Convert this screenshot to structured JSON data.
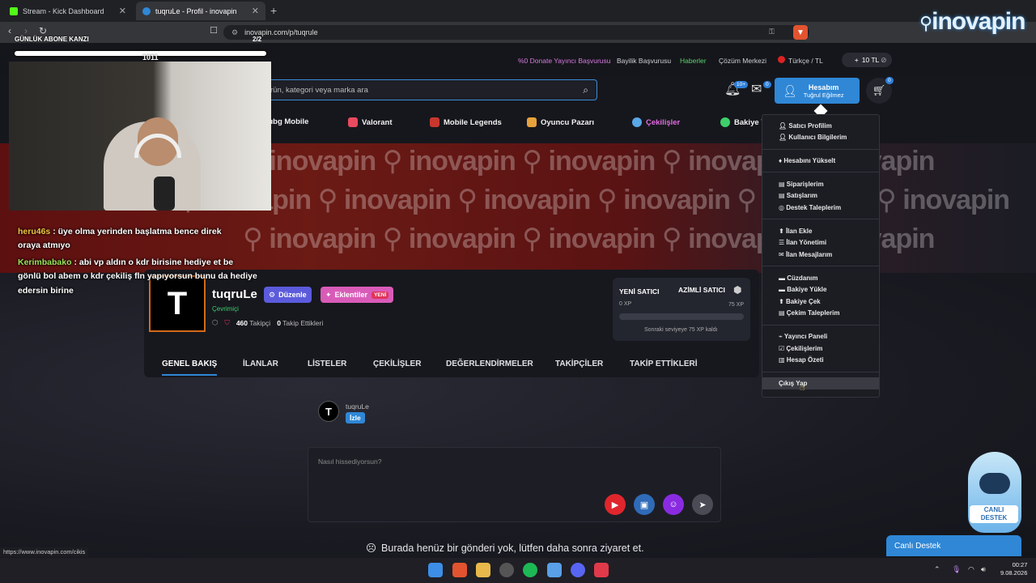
{
  "browser": {
    "tabs": [
      {
        "title": "Stream - Kick Dashboard",
        "color": "#53fc18"
      },
      {
        "title": "tuqruLe - Profil - inovapin",
        "color": "#2f87d6"
      }
    ],
    "url": "inovapin.com/p/tuqrule",
    "status_url": "https://www.inovapin.com/cikis"
  },
  "stream_overlay": {
    "title": "GÜNLÜK ABONE KANZI",
    "count": "2/2",
    "bar_label": "1011",
    "chat": [
      {
        "user": "heru46s",
        "text": ": üye olma yerinden başlatma bence direk",
        "color": "#f4c542"
      },
      {
        "user": "",
        "text": "oraya atmıyo",
        "color": "#ffffff"
      },
      {
        "user": "Kerimbabako",
        "text": ": abi vp aldın o kdr birisine hediye et be",
        "color": "#9be35c"
      },
      {
        "user": "",
        "text": "gönlü bol abem o kdr çekiliş fln yapıyorsun bunu da hediye",
        "color": "#ffffff"
      },
      {
        "user": "",
        "text": "edersin birine",
        "color": "#ffffff"
      }
    ]
  },
  "site": {
    "logo": "inovapin",
    "top_links": [
      "%0 Donate Yayıncı Başvurusu",
      "Bayilik Başvurusu",
      "Haberler",
      "Çözüm Merkezi",
      "Türkçe / TL"
    ],
    "balance": "10 TL",
    "search_placeholder": "rün, kategori veya marka ara",
    "notif_badge": "10+",
    "mail_badge": "0",
    "cart_badge": "0",
    "account": {
      "title": "Hesabım",
      "name": "Tuğrul Eğilmez"
    },
    "categories": [
      "Pubg Mobile",
      "Valorant",
      "Mobile Legends",
      "Oyuncu Pazarı",
      "Çekilişler",
      "Bakiye Y"
    ],
    "banner_watermark": "inovapin",
    "profile": {
      "username": "tuqruLe",
      "status": "Çevrimiçi",
      "edit_label": "Düzenle",
      "plugins_label": "Eklentiler",
      "new_label": "YENİ",
      "followers_count": "460",
      "followers_label": "Takipçi",
      "following_count": "0",
      "following_label": "Takip Ettikleri",
      "xp": {
        "current_level": "YENİ SATICI",
        "next_level": "AZİMLİ SATICI",
        "current_xp": "0 XP",
        "next_xp": "75 XP",
        "progress": 0,
        "note": "Sonraki seviyeye 75 XP kaldı"
      }
    },
    "profile_tabs": [
      "GENEL BAKIŞ",
      "İLANLAR",
      "LİSTELER",
      "ÇEKİLİŞLER",
      "DEĞERLENDİRMELER",
      "TAKİPÇİLER",
      "TAKİP ETTİKLERİ"
    ],
    "post": {
      "user": "tuqruLe",
      "watch_label": "İzle"
    },
    "composer_placeholder": "Nasıl hissediyorsun?",
    "empty_message": "Burada henüz bir gönderi yok, lütfen daha sonra ziyaret et.",
    "dropdown": {
      "items": [
        "Satıcı Profilim",
        "Kullanıcı Bilgilerim",
        "Hesabını Yükselt",
        "Siparişlerim",
        "Satışlarım",
        "Destek Taleplerim",
        "İlan Ekle",
        "İlan Yönetimi",
        "İlan Mesajlarım",
        "Cüzdanım",
        "Bakiye Yükle",
        "Bakiye Çek",
        "Çekim Taleplerim",
        "Yayıncı Paneli",
        "Çekilişlerim",
        "Hesap Özeti",
        "Çıkış Yap"
      ]
    },
    "live_support": "Canlı Destek",
    "mascot_label_1": "CANLI",
    "mascot_label_2": "DESTEK"
  },
  "taskbar": {
    "time": "00:27",
    "date": "9.08.2026"
  }
}
